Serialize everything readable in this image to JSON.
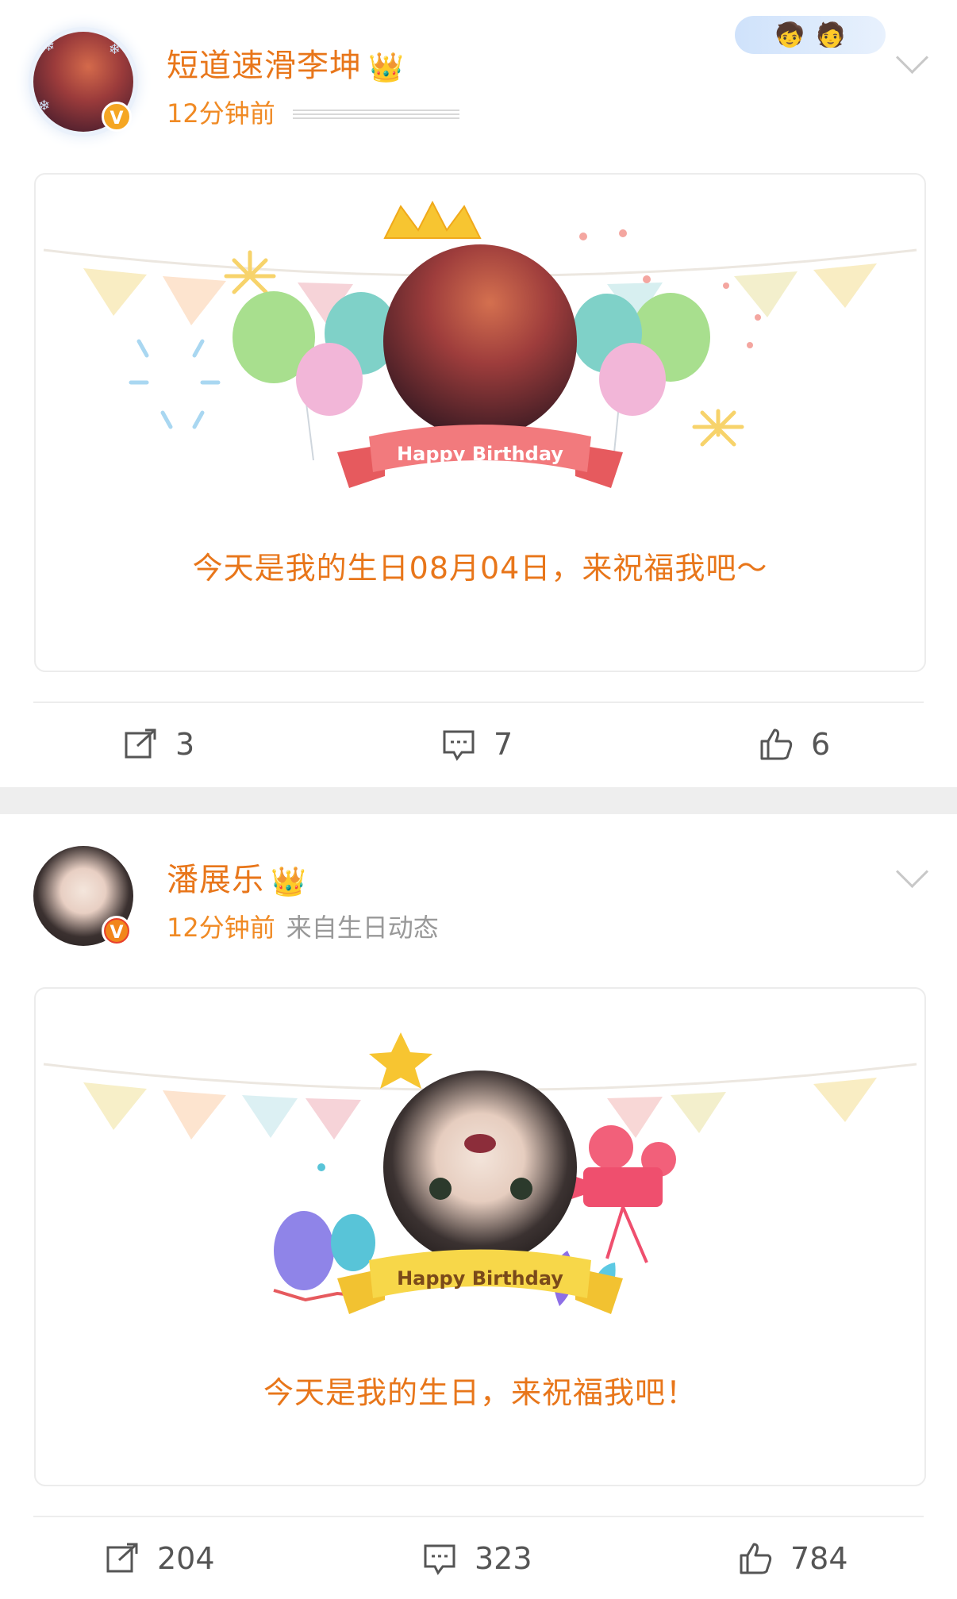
{
  "posts": [
    {
      "username": "短道速滑李坤",
      "time": "12分钟前",
      "source": "",
      "card_badge": "Happy Birthday",
      "card_text": "今天是我的生日08月04日，来祝福我吧～",
      "actions": {
        "repost": "3",
        "comment": "7",
        "like": "6"
      }
    },
    {
      "username": "潘展乐",
      "time": "12分钟前",
      "source": "来自生日动态",
      "card_badge": "Happy Birthday",
      "card_text": "今天是我的生日，来祝福我吧！",
      "actions": {
        "repost": "204",
        "comment": "323",
        "like": "784"
      }
    }
  ],
  "badge_letter": "V",
  "icons": [
    "repost-icon",
    "comment-icon",
    "like-icon",
    "crown-icon",
    "chevron-down-icon"
  ],
  "colors": {
    "accent": "#e8761a",
    "meta": "#f08a24",
    "separator": "#eeeeee"
  }
}
